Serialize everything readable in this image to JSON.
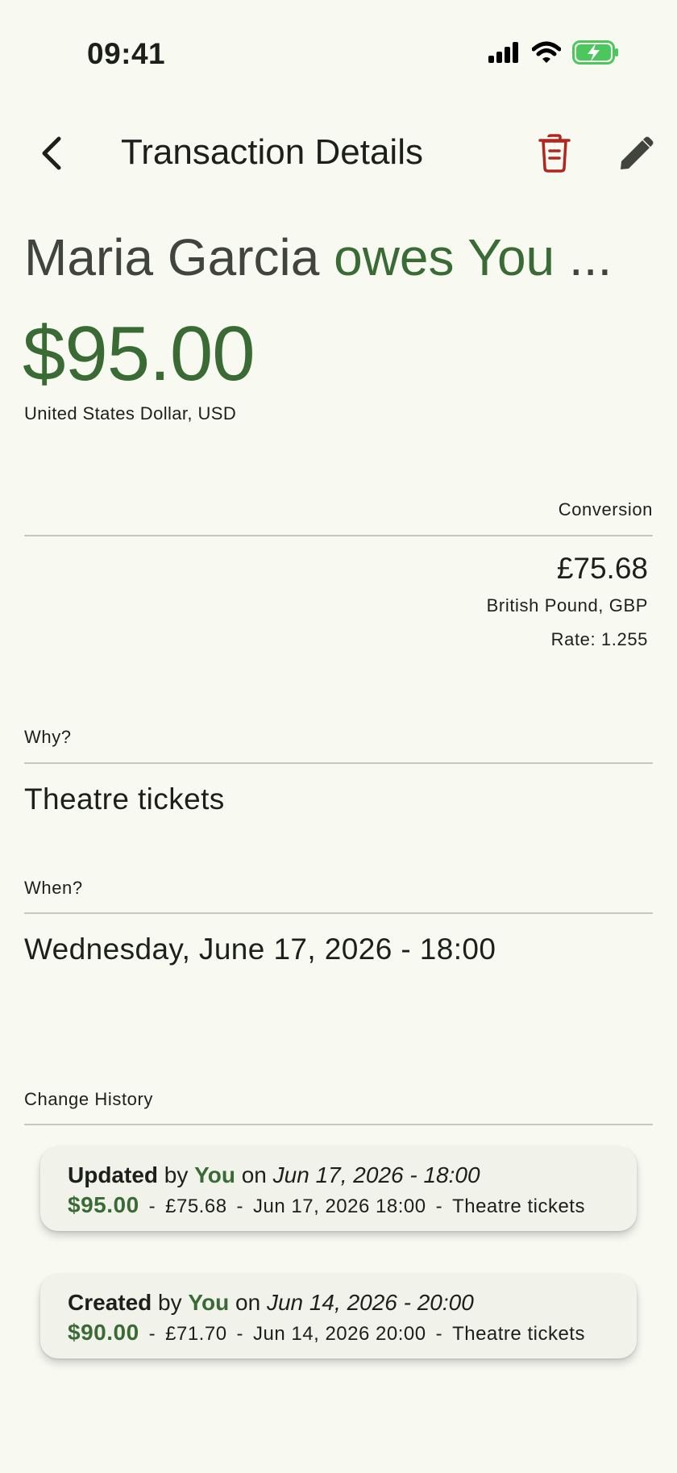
{
  "status": {
    "time": "09:41"
  },
  "app_bar": {
    "title": "Transaction Details"
  },
  "headline": {
    "person": "Maria Garcia",
    "relation": "owes You",
    "ellipsis": " ..."
  },
  "amount": {
    "value": "$95.00",
    "currency": "United States Dollar, USD"
  },
  "conversion": {
    "label": "Conversion",
    "amount": "£75.68",
    "currency": "British Pound, GBP",
    "rate": "Rate: 1.255"
  },
  "why": {
    "label": "Why?",
    "value": "Theatre tickets"
  },
  "when": {
    "label": "When?",
    "value": "Wednesday, June 17, 2026 - 18:00"
  },
  "history": {
    "label": "Change History",
    "entries": [
      {
        "action": "Updated",
        "by": "by",
        "who": "You",
        "on": "on",
        "when": "Jun 17, 2026 - 18:00",
        "amount": "$95.00",
        "converted": "£75.68",
        "date": "Jun 17, 2026 18:00",
        "note": "Theatre tickets"
      },
      {
        "action": "Created",
        "by": "by",
        "who": "You",
        "on": "on",
        "when": "Jun 14, 2026 - 20:00",
        "amount": "$90.00",
        "converted": "£71.70",
        "date": "Jun 14, 2026 20:00",
        "note": "Theatre tickets"
      }
    ]
  },
  "colors": {
    "accent": "#3a6b35",
    "danger": "#b3261e",
    "background": "#f8faf2"
  },
  "icons": [
    "signal-icon",
    "wifi-icon",
    "battery-charging-icon",
    "back-arrow-icon",
    "trash-icon",
    "pencil-icon"
  ]
}
